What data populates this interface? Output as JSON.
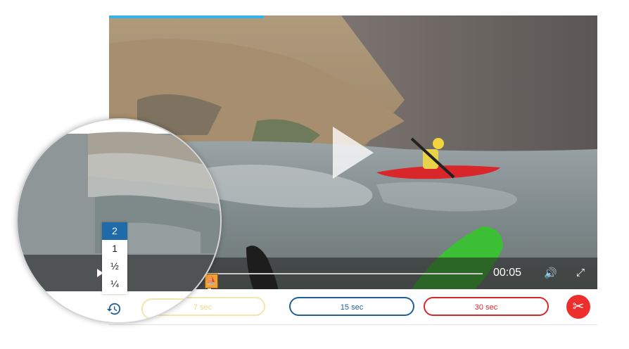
{
  "player": {
    "time": "00:05",
    "progress": 0.12,
    "marker_icon": "kayaker-marker-icon"
  },
  "skip_buttons": [
    {
      "label": "7 sec",
      "color": "#e9d98e"
    },
    {
      "label": "15 sec",
      "color": "#1f5f9e"
    },
    {
      "label": "30 sec",
      "color": "#d42a2a"
    }
  ],
  "speed_menu": {
    "options": [
      "2",
      "1",
      "½",
      "¼"
    ],
    "selected": "2"
  },
  "colors": {
    "accent_blue": "#1f6aa8",
    "clip_red": "#ee2d2d",
    "topline": "#36b4e5"
  }
}
